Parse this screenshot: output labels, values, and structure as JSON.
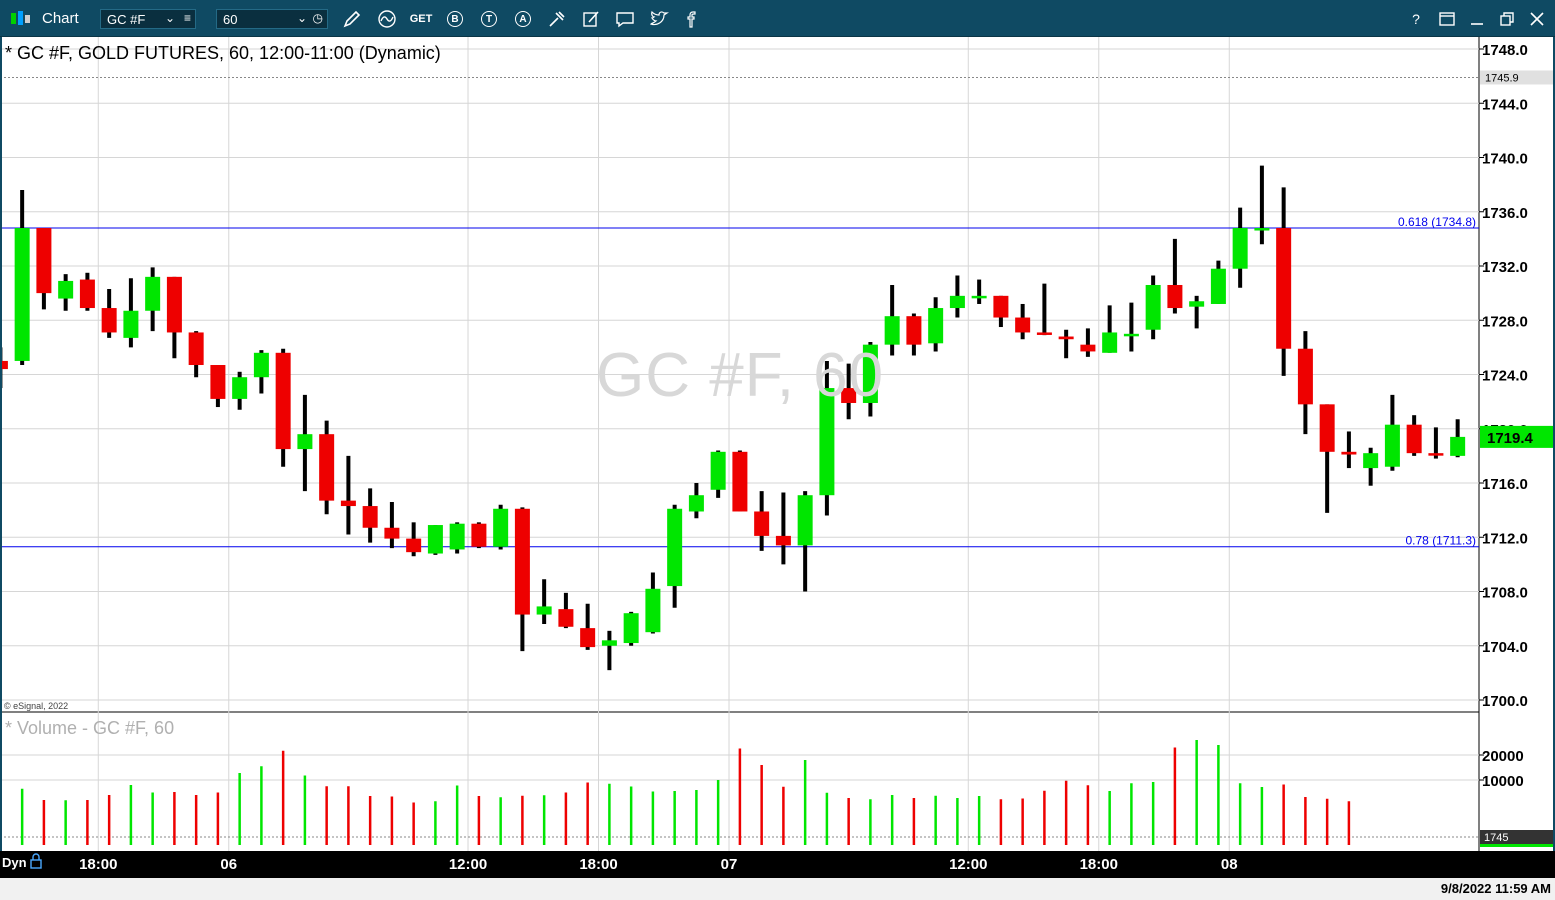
{
  "app": {
    "window_label": "Chart",
    "symbol_value": "GC #F",
    "interval_value": "60",
    "get_label": "GET",
    "icons": [
      "chart-logo-icon",
      "pencil-icon",
      "squiggle-icon",
      "get-icon",
      "b-icon",
      "t-icon",
      "a-icon",
      "tools-icon",
      "note-icon",
      "comment-icon",
      "twitter-icon",
      "facebook-icon",
      "help-icon",
      "page-settings-icon",
      "minimize-icon",
      "restore-icon",
      "close-icon",
      "lock-icon"
    ],
    "help_label": "?",
    "datetime": "9/8/2022 11:59 AM",
    "dyn_label": "Dyn"
  },
  "chart_data": [
    {
      "type": "candlestick",
      "title": "* GC #F, GOLD FUTURES, 60, 12:00-11:00 (Dynamic)",
      "watermark": "GC #F, 60",
      "copyright": "© eSignal, 2022",
      "ylim": [
        1699,
        1749.5
      ],
      "y_ticks": [
        1700,
        1704,
        1708,
        1712,
        1716,
        1720,
        1724,
        1728,
        1732,
        1736,
        1740,
        1744,
        1748
      ],
      "y_tick_labels": [
        "1700.0",
        "1704.0",
        "1708.0",
        "1712.0",
        "1716.0",
        "1720.0",
        "1724.0",
        "1728.0",
        "1732.0",
        "1736.0",
        "1740.0",
        "1744.0",
        "1748.0"
      ],
      "x_tick_labels": [
        {
          "label": "18:00",
          "bar": 4.5
        },
        {
          "label": "06",
          "bar": 10.5
        },
        {
          "label": "12:00",
          "bar": 21.5
        },
        {
          "label": "18:00",
          "bar": 27.5
        },
        {
          "label": "07",
          "bar": 33.5
        },
        {
          "label": "12:00",
          "bar": 44.5
        },
        {
          "label": "18:00",
          "bar": 50.5
        },
        {
          "label": "08",
          "bar": 56.5
        }
      ],
      "last_price": 1719.4,
      "last_price_label": "1719.4",
      "reference_line": {
        "value": 1745.9,
        "label": "1745.9"
      },
      "fib_levels": [
        {
          "value": 1734.8,
          "label": "0.618 (1734.8)"
        },
        {
          "value": 1711.3,
          "label": "0.78 (1711.3)"
        }
      ],
      "grid": true,
      "candles": [
        {
          "o": 1725,
          "h": 1726,
          "l": 1723,
          "c": 1724.4
        },
        {
          "o": 1725,
          "h": 1737.6,
          "l": 1724.7,
          "c": 1734.8
        },
        {
          "o": 1734.8,
          "h": 1734.8,
          "l": 1728.8,
          "c": 1730.0
        },
        {
          "o": 1729.6,
          "h": 1731.4,
          "l": 1728.7,
          "c": 1730.9
        },
        {
          "o": 1731.0,
          "h": 1731.5,
          "l": 1728.7,
          "c": 1728.9
        },
        {
          "o": 1728.9,
          "h": 1730.3,
          "l": 1726.7,
          "c": 1727.1
        },
        {
          "o": 1726.7,
          "h": 1731.1,
          "l": 1726.0,
          "c": 1728.7
        },
        {
          "o": 1728.7,
          "h": 1731.9,
          "l": 1727.2,
          "c": 1731.2
        },
        {
          "o": 1731.2,
          "h": 1731.2,
          "l": 1725.2,
          "c": 1727.1
        },
        {
          "o": 1727.1,
          "h": 1727.2,
          "l": 1723.8,
          "c": 1724.7
        },
        {
          "o": 1724.7,
          "h": 1724.7,
          "l": 1721.6,
          "c": 1722.2
        },
        {
          "o": 1722.2,
          "h": 1724.2,
          "l": 1721.4,
          "c": 1723.8
        },
        {
          "o": 1723.8,
          "h": 1725.8,
          "l": 1722.6,
          "c": 1725.6
        },
        {
          "o": 1725.6,
          "h": 1725.9,
          "l": 1717.2,
          "c": 1718.5
        },
        {
          "o": 1718.5,
          "h": 1722.5,
          "l": 1715.4,
          "c": 1719.6
        },
        {
          "o": 1719.6,
          "h": 1720.6,
          "l": 1713.7,
          "c": 1714.7
        },
        {
          "o": 1714.7,
          "h": 1718.0,
          "l": 1712.2,
          "c": 1714.3
        },
        {
          "o": 1714.3,
          "h": 1715.6,
          "l": 1711.6,
          "c": 1712.7
        },
        {
          "o": 1712.7,
          "h": 1714.6,
          "l": 1711.2,
          "c": 1711.9
        },
        {
          "o": 1711.9,
          "h": 1713.1,
          "l": 1710.6,
          "c": 1710.9
        },
        {
          "o": 1710.8,
          "h": 1712.9,
          "l": 1710.7,
          "c": 1712.9
        },
        {
          "o": 1711.1,
          "h": 1713.1,
          "l": 1710.8,
          "c": 1713.0
        },
        {
          "o": 1713.0,
          "h": 1713.1,
          "l": 1711.2,
          "c": 1711.3
        },
        {
          "o": 1711.3,
          "h": 1714.4,
          "l": 1711.1,
          "c": 1714.1
        },
        {
          "o": 1714.1,
          "h": 1714.2,
          "l": 1703.6,
          "c": 1706.3
        },
        {
          "o": 1706.3,
          "h": 1708.9,
          "l": 1705.6,
          "c": 1706.9
        },
        {
          "o": 1706.7,
          "h": 1707.9,
          "l": 1705.3,
          "c": 1705.4
        },
        {
          "o": 1705.3,
          "h": 1707.1,
          "l": 1703.7,
          "c": 1703.9
        },
        {
          "o": 1704.0,
          "h": 1705.1,
          "l": 1702.2,
          "c": 1704.4
        },
        {
          "o": 1704.2,
          "h": 1706.5,
          "l": 1704.0,
          "c": 1706.4
        },
        {
          "o": 1705.0,
          "h": 1709.4,
          "l": 1704.9,
          "c": 1708.2
        },
        {
          "o": 1708.4,
          "h": 1714.4,
          "l": 1706.8,
          "c": 1714.1
        },
        {
          "o": 1713.9,
          "h": 1716.0,
          "l": 1713.4,
          "c": 1715.1
        },
        {
          "o": 1715.5,
          "h": 1718.4,
          "l": 1714.9,
          "c": 1718.3
        },
        {
          "o": 1718.3,
          "h": 1718.4,
          "l": 1713.9,
          "c": 1713.9
        },
        {
          "o": 1713.9,
          "h": 1715.4,
          "l": 1711.0,
          "c": 1712.1
        },
        {
          "o": 1712.1,
          "h": 1715.3,
          "l": 1710.0,
          "c": 1711.4
        },
        {
          "o": 1711.4,
          "h": 1715.4,
          "l": 1708.0,
          "c": 1715.1
        },
        {
          "o": 1715.1,
          "h": 1725.0,
          "l": 1713.6,
          "c": 1723.0
        },
        {
          "o": 1723.0,
          "h": 1724.8,
          "l": 1720.7,
          "c": 1721.9
        },
        {
          "o": 1721.9,
          "h": 1726.4,
          "l": 1720.9,
          "c": 1726.2
        },
        {
          "o": 1726.2,
          "h": 1730.6,
          "l": 1725.4,
          "c": 1728.3
        },
        {
          "o": 1728.3,
          "h": 1728.5,
          "l": 1725.4,
          "c": 1726.2
        },
        {
          "o": 1726.3,
          "h": 1729.7,
          "l": 1725.7,
          "c": 1728.9
        },
        {
          "o": 1728.9,
          "h": 1731.3,
          "l": 1728.2,
          "c": 1729.8
        },
        {
          "o": 1729.8,
          "h": 1731.0,
          "l": 1729.2,
          "c": 1729.8
        },
        {
          "o": 1729.8,
          "h": 1729.8,
          "l": 1727.5,
          "c": 1728.2
        },
        {
          "o": 1728.2,
          "h": 1729.2,
          "l": 1726.6,
          "c": 1727.1
        },
        {
          "o": 1727.1,
          "h": 1730.7,
          "l": 1726.9,
          "c": 1727.0
        },
        {
          "o": 1726.8,
          "h": 1727.3,
          "l": 1725.2,
          "c": 1726.6
        },
        {
          "o": 1726.2,
          "h": 1727.4,
          "l": 1725.3,
          "c": 1725.7
        },
        {
          "o": 1725.6,
          "h": 1729.1,
          "l": 1725.6,
          "c": 1727.1
        },
        {
          "o": 1727.0,
          "h": 1729.3,
          "l": 1725.7,
          "c": 1727.0
        },
        {
          "o": 1727.3,
          "h": 1731.3,
          "l": 1726.6,
          "c": 1730.6
        },
        {
          "o": 1730.6,
          "h": 1734.0,
          "l": 1728.5,
          "c": 1728.9
        },
        {
          "o": 1729.0,
          "h": 1729.8,
          "l": 1727.4,
          "c": 1729.4
        },
        {
          "o": 1729.2,
          "h": 1732.4,
          "l": 1729.2,
          "c": 1731.8
        },
        {
          "o": 1731.8,
          "h": 1736.3,
          "l": 1730.4,
          "c": 1734.8
        },
        {
          "o": 1734.8,
          "h": 1739.4,
          "l": 1733.6,
          "c": 1734.8
        },
        {
          "o": 1734.8,
          "h": 1737.8,
          "l": 1723.9,
          "c": 1725.9
        },
        {
          "o": 1725.9,
          "h": 1727.2,
          "l": 1719.6,
          "c": 1721.8
        },
        {
          "o": 1721.8,
          "h": 1721.8,
          "l": 1713.8,
          "c": 1718.3
        },
        {
          "o": 1718.3,
          "h": 1719.8,
          "l": 1717.1,
          "c": 1718.1
        },
        {
          "o": 1717.1,
          "h": 1718.6,
          "l": 1715.8,
          "c": 1718.2
        },
        {
          "o": 1717.2,
          "h": 1722.5,
          "l": 1716.9,
          "c": 1720.3
        },
        {
          "o": 1720.3,
          "h": 1721.0,
          "l": 1718.0,
          "c": 1718.2
        },
        {
          "o": 1718.2,
          "h": 1720.1,
          "l": 1717.8,
          "c": 1718.1
        },
        {
          "o": 1718.0,
          "h": 1720.7,
          "l": 1717.9,
          "c": 1719.4
        }
      ]
    },
    {
      "type": "bar",
      "title": "* Volume - GC #F, 60",
      "ylim": [
        0,
        30000
      ],
      "y_ticks": [
        10000,
        20000
      ],
      "y_tick_labels": [
        "10000",
        "20000"
      ],
      "reference_line": {
        "value": 1745,
        "label": "1745"
      },
      "values": [
        8500,
        6500,
        2000,
        1900,
        2000,
        4000,
        8000,
        5000,
        5200,
        4000,
        5000,
        12800,
        15500,
        21700,
        11800,
        7500,
        7500,
        3600,
        3400,
        1000,
        1500,
        7800,
        3600,
        3100,
        3700,
        3900,
        5000,
        9000,
        8500,
        7400,
        5400,
        5600,
        6000,
        10000,
        22600,
        16000,
        7300,
        18000,
        4900,
        2800,
        2300,
        4000,
        2800,
        3700,
        2800,
        3600,
        2300,
        2600,
        5700,
        9700,
        7900,
        5600,
        8700,
        9200,
        23000,
        26000,
        24000,
        8700,
        7200,
        8200,
        3200,
        2500,
        1500
      ],
      "colors_by_bar": "green=up, red=down"
    }
  ],
  "colors": {
    "up": "#00e600",
    "down": "#ee0000",
    "wick": "#000000",
    "fib": "#0000ee",
    "grid": "#d6d6d6",
    "last_price_bg": "#00e600",
    "titlebar": "#0f4a63"
  }
}
